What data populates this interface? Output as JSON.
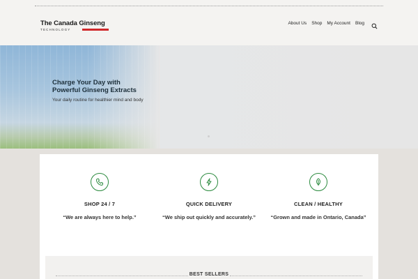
{
  "header": {
    "logo_title": "The Canada Ginseng",
    "logo_subtitle": "TECHNOLOGY",
    "nav": [
      "About Us",
      "Shop",
      "My Account",
      "Blog"
    ],
    "search_icon": "search-icon"
  },
  "hero": {
    "title_line1": "Charge Your Day with",
    "title_line2": "Powerful Ginseng Extracts",
    "subtitle": "Your daily routine for healthier mind and body"
  },
  "features": [
    {
      "icon": "phone-icon",
      "title": "SHOP 24 / 7",
      "text": "“We are always here to help.”"
    },
    {
      "icon": "lightning-icon",
      "title": "QUICK DELIVERY",
      "text": "“We ship out quickly and accurately.”"
    },
    {
      "icon": "leaf-icon",
      "title": "CLEAN / HEALTHY",
      "text": "“Grown and made in Ontario, Canada”"
    }
  ],
  "bestsellers": {
    "label": "BEST SELLERS"
  },
  "colors": {
    "accent_green": "#2b8a3e",
    "logo_red": "#d0282b",
    "page_bg": "#e4e1dd"
  }
}
